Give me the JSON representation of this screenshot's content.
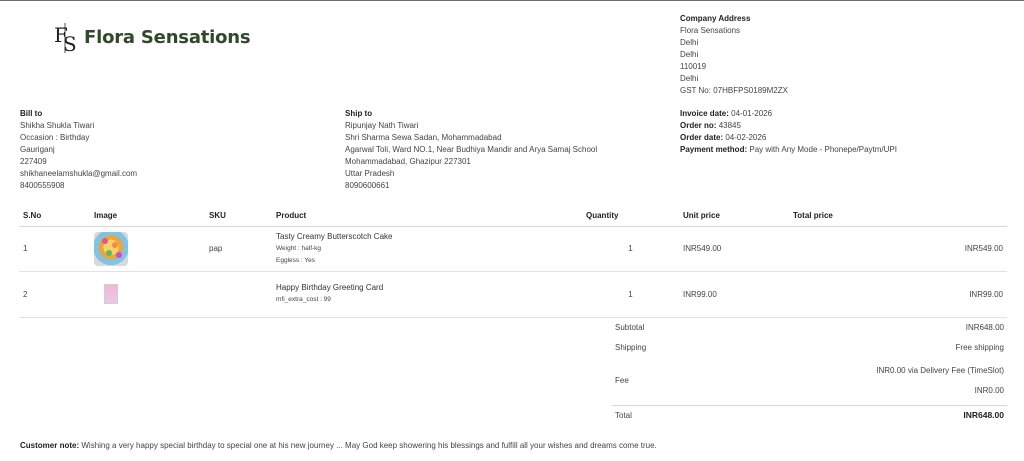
{
  "brand": {
    "name": "Flora Sensations",
    "logo_letters": "FS"
  },
  "company": {
    "heading": "Company Address",
    "lines": [
      "Flora Sensations",
      "Delhi",
      "Delhi",
      "110019",
      "Delhi"
    ],
    "gst_label": "GST No:",
    "gst_value": "07HBFPS0189M2ZX"
  },
  "bill_to": {
    "heading": "Bill to",
    "lines": [
      "Shikha Shukla Tiwari",
      "Occasion : Birthday",
      "Gauriganj",
      "227409",
      "shikhaneelamshukla@gmail.com",
      "8400555908"
    ]
  },
  "ship_to": {
    "heading": "Ship to",
    "lines": [
      "Ripunjay Nath Tiwari",
      "Shri Sharma Sewa Sadan, Mohammadabad",
      "Agarwal Toli, Ward NO.1, Near Budhiya Mandir and Arya Samaj School",
      "Mohammadabad, Ghazipur 227301",
      "Uttar Pradesh",
      "8090600661"
    ]
  },
  "invoice": {
    "invoice_date_label": "Invoice date:",
    "invoice_date": "04-01-2026",
    "order_no_label": "Order no:",
    "order_no": "43845",
    "order_date_label": "Order date:",
    "order_date": "04-02-2026",
    "payment_label": "Payment method:",
    "payment": "Pay with Any Mode - Phonepe/Paytm/UPI"
  },
  "table": {
    "headers": {
      "sno": "S.No",
      "image": "Image",
      "sku": "SKU",
      "product": "Product",
      "quantity": "Quantity",
      "unit_price": "Unit price",
      "total_price": "Total price"
    },
    "rows": [
      {
        "sno": "1",
        "image": "cake-image",
        "sku": "pap",
        "product": "Tasty Creamy Butterscotch Cake",
        "meta": [
          "Weight : half-kg",
          "Eggless : Yes"
        ],
        "quantity": "1",
        "unit_price": "INR549.00",
        "total_price": "INR549.00"
      },
      {
        "sno": "2",
        "image": "greeting-card-image",
        "sku": "",
        "product": "Happy Birthday Greeting Card",
        "meta": [
          "mfi_extra_cost : 99"
        ],
        "quantity": "1",
        "unit_price": "INR99.00",
        "total_price": "INR99.00"
      }
    ]
  },
  "totals": {
    "subtotal_label": "Subtotal",
    "subtotal": "INR648.00",
    "shipping_label": "Shipping",
    "shipping": "Free shipping",
    "fee_label": "Fee",
    "fee_line1": "INR0.00 via Delivery Fee (TimeSlot)",
    "fee_line2": "INR0.00",
    "total_label": "Total",
    "total": "INR648.00"
  },
  "note": {
    "label": "Customer note:",
    "text": "Wishing a very happy special birthday to special one at his new journey ... May God keep showering his blessings and fulfill all your wishes and dreams come true."
  },
  "colors": {
    "brand_green": "#2f4a2a"
  }
}
